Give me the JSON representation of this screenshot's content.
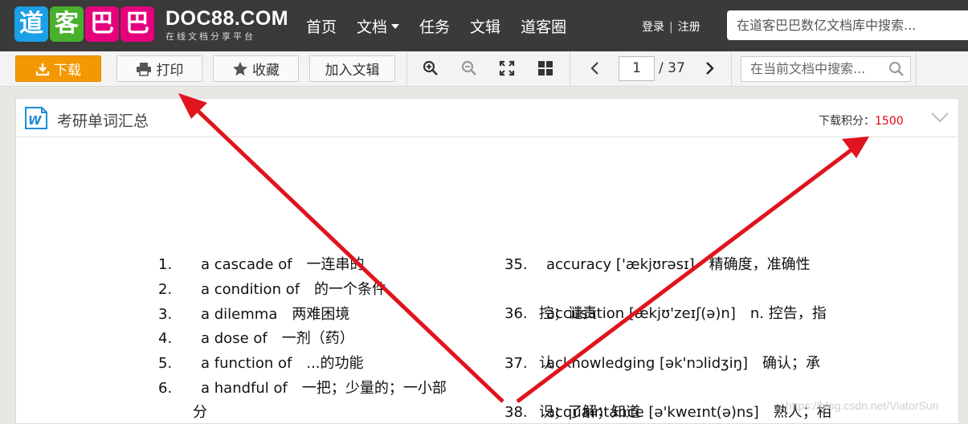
{
  "header": {
    "logo_chars": [
      "道",
      "客",
      "巴",
      "巴"
    ],
    "logo_colors": [
      "#1aa0e6",
      "#49b02d",
      "#e6007e",
      "#e6007e"
    ],
    "brand_en": "DOC88.COM",
    "brand_cn": "在线文档分享平台",
    "nav": [
      "首页",
      "文档",
      "任务",
      "文辑",
      "道客圈"
    ],
    "login": "登录",
    "divider": "|",
    "register": "注册",
    "search_placeholder": "在道客巴巴数亿文档库中搜索..."
  },
  "toolbar": {
    "download": "下载",
    "print": "打印",
    "favorite": "收藏",
    "add_collection": "加入文辑",
    "page_current": "1",
    "page_total": "/ 37",
    "search_placeholder": "在当前文档中搜索..."
  },
  "doc": {
    "title": "考研单词汇总",
    "score_label": "下载积分：",
    "score_value": "1500",
    "left_entries": [
      {
        "num": "1.",
        "text": "a cascade of　一连串的"
      },
      {
        "num": "2.",
        "text": "a condition of　的一个条件"
      },
      {
        "num": "3.",
        "text": "a dilemma　两难困境"
      },
      {
        "num": "4.",
        "text": "a dose of　一剂（药）"
      },
      {
        "num": "5.",
        "text": "a function of　...的功能"
      },
      {
        "num": "6.",
        "text": "a handful of　一把；少量的；一小部"
      }
    ],
    "left_cont": "分",
    "right_entries": [
      {
        "num": "35.",
        "text": "accuracy ['ækjʊrəsɪ]　精确度，准确性"
      },
      {
        "num": "36.",
        "text": "accusation [ækjʊ'zeɪʃ(ə)n]　n. 控告，指"
      },
      {
        "num": "37.",
        "text": "acknowledging [ək'nɔlidʒiŋ]　确认；承"
      },
      {
        "num": "38.",
        "text": "acquaintance [ə'kweɪnt(ə)ns]　熟人；相"
      }
    ],
    "right_cont": [
      "控；谴责",
      "认",
      "识；了解；知道"
    ]
  },
  "watermark": "https://blog.csdn.net/ViatorSun",
  "colors": {
    "accent_orange": "#f39800",
    "arrow_red": "#e0141e",
    "score_red": "#e60012"
  }
}
